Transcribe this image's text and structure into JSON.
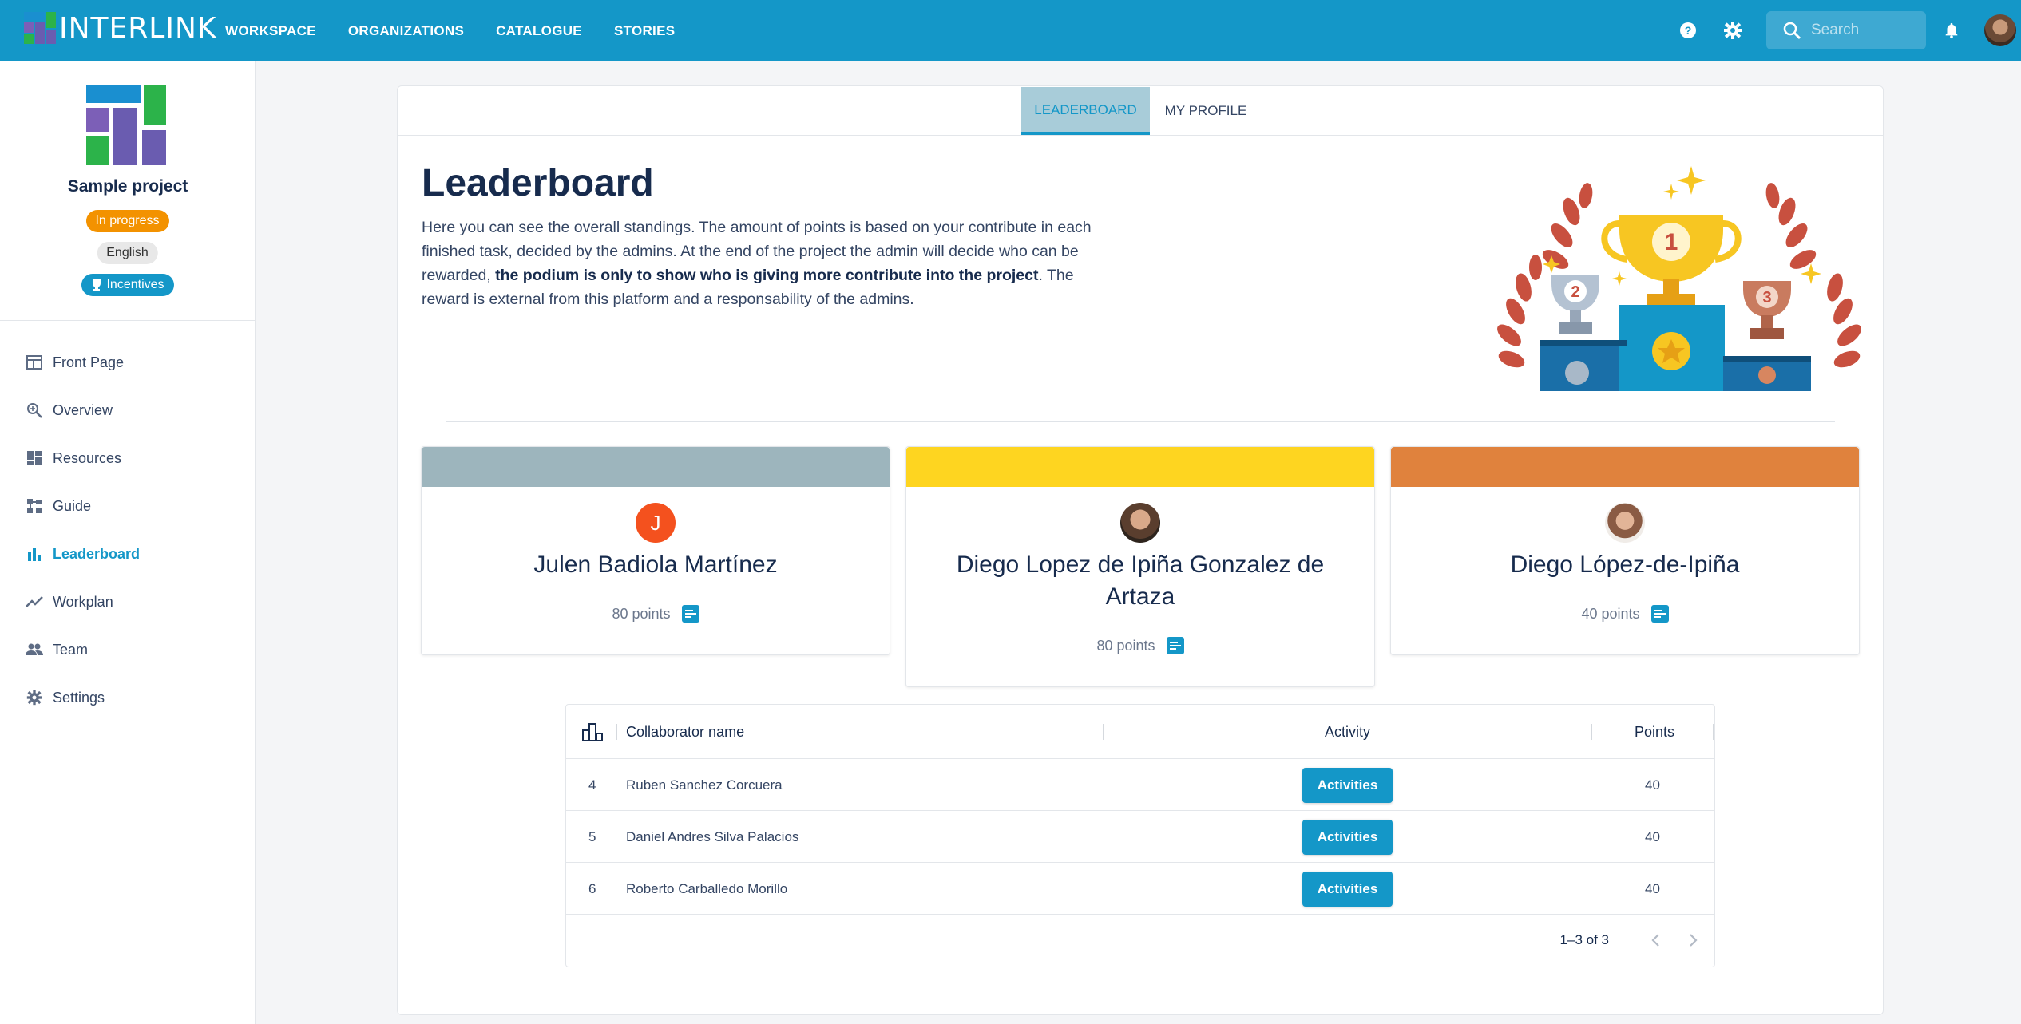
{
  "topbar": {
    "logo_text": "INTERLINK",
    "nav": [
      "WORKSPACE",
      "ORGANIZATIONS",
      "CATALOGUE",
      "STORIES"
    ],
    "icons": [
      "help-icon",
      "gear-icon",
      "bell-icon"
    ],
    "search_placeholder": "Search"
  },
  "sidebar": {
    "project_name": "Sample project",
    "status": "In progress",
    "language": "English",
    "incentives": "Incentives",
    "items": [
      {
        "label": "Front Page",
        "icon": "front-page-icon"
      },
      {
        "label": "Overview",
        "icon": "overview-icon"
      },
      {
        "label": "Resources",
        "icon": "resources-icon"
      },
      {
        "label": "Guide",
        "icon": "guide-icon"
      },
      {
        "label": "Leaderboard",
        "icon": "leaderboard-icon",
        "active": true
      },
      {
        "label": "Workplan",
        "icon": "workplan-icon"
      },
      {
        "label": "Team",
        "icon": "team-icon"
      },
      {
        "label": "Settings",
        "icon": "settings-icon"
      }
    ]
  },
  "tabs": {
    "leaderboard": "LEADERBOARD",
    "profile": "MY PROFILE"
  },
  "main": {
    "title": "Leaderboard",
    "desc_part1": "Here you can see the overall standings. The amount of points is based on your contribute in each finished task, decided by the admins. At the end of the project the admin will decide who can be rewarded, ",
    "desc_bold": "the podium is only to show who is giving more contribute into the project",
    "desc_part2": ". The reward is external from this platform and a responsability of the admins."
  },
  "podium": [
    {
      "name": "Julen Badiola Martínez",
      "points": "80 points",
      "initial": "J",
      "color": "#9db5bd"
    },
    {
      "name": "Diego Lopez de Ipiña Gonzalez de Artaza",
      "points": "80 points",
      "color": "#fed520"
    },
    {
      "name": "Diego López-de-Ipiña",
      "points": "40 points",
      "color": "#e0823d"
    }
  ],
  "table": {
    "headers": {
      "name": "Collaborator name",
      "activity": "Activity",
      "points": "Points"
    },
    "rows": [
      {
        "rank": "4",
        "name": "Ruben Sanchez Corcuera",
        "activity": "Activities",
        "points": "40"
      },
      {
        "rank": "5",
        "name": "Daniel Andres Silva Palacios",
        "activity": "Activities",
        "points": "40"
      },
      {
        "rank": "6",
        "name": "Roberto Carballedo Morillo",
        "activity": "Activities",
        "points": "40"
      }
    ],
    "pagination": "1–3 of 3"
  }
}
